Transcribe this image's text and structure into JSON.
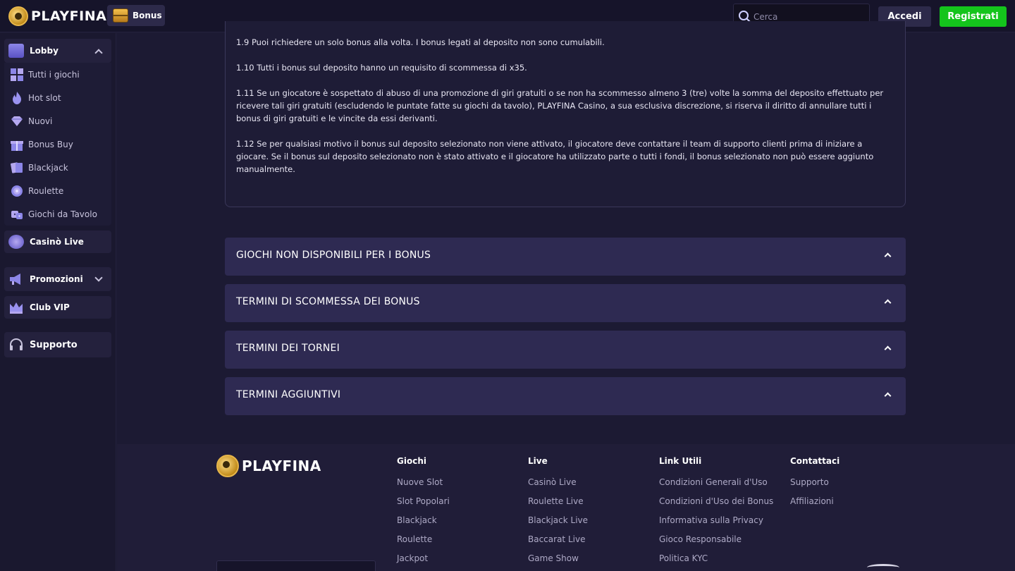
{
  "header": {
    "logo_text": "PLAYFINA",
    "bonus_label": "Bonus",
    "search_placeholder": "Cerca",
    "login_label": "Accedi",
    "register_label": "Registrati"
  },
  "sidebar": {
    "lobby_label": "Lobby",
    "lobby_items": [
      {
        "label": "Tutti i giochi",
        "icon": "grid-icon"
      },
      {
        "label": "Hot slot",
        "icon": "flame-icon"
      },
      {
        "label": "Nuovi",
        "icon": "diamond-icon"
      },
      {
        "label": "Bonus Buy",
        "icon": "gift-icon"
      },
      {
        "label": "Blackjack",
        "icon": "cards-icon"
      },
      {
        "label": "Roulette",
        "icon": "roulette-icon"
      },
      {
        "label": "Giochi da Tavolo",
        "icon": "dice-icon"
      }
    ],
    "live_label": "Casinò Live",
    "promo_label": "Promozioni",
    "vip_label": "Club VIP",
    "support_label": "Supporto"
  },
  "terms": {
    "p1": "1.9 Puoi richiedere un solo bonus alla volta. I bonus legati al deposito non sono cumulabili.",
    "p2": "1.10 Tutti i bonus sul deposito hanno un requisito di scommessa di x35.",
    "p3": "1.11 Se un giocatore è sospettato di abuso di una promozione di giri gratuiti o se non ha scommesso almeno 3 (tre) volte la somma del deposito effettuato per ricevere tali giri gratuiti (escludendo le puntate fatte su giochi da tavolo), PLAYFINA Casino, a sua esclusiva discrezione, si riserva il diritto di annullare tutti i bonus di giri gratuiti e le vincite da essi derivanti.",
    "p4": "1.12 Se per qualsiasi motivo il bonus sul deposito selezionato non viene attivato, il giocatore deve contattare il team di supporto clienti prima di iniziare a giocare. Se il bonus sul deposito selezionato non è stato attivato e il giocatore ha utilizzato parte o tutti i fondi, il bonus selezionato non può essere aggiunto manualmente."
  },
  "accordions": [
    "GIOCHI NON DISPONIBILI PER I BONUS",
    "TERMINI DI SCOMMESSA DEI BONUS",
    "TERMINI DEI TORNEI",
    "TERMINI AGGIUNTIVI"
  ],
  "footer": {
    "logo_text": "PLAYFINA",
    "columns": [
      {
        "head": "Giochi",
        "links": [
          "Nuove Slot",
          "Slot Popolari",
          "Blackjack",
          "Roulette",
          "Jackpot"
        ]
      },
      {
        "head": "Live",
        "links": [
          "Casinò Live",
          "Roulette Live",
          "Blackjack Live",
          "Baccarat Live",
          "Game Show"
        ]
      },
      {
        "head": "Link Utili",
        "links": [
          "Condizioni Generali d'Uso",
          "Condizioni d'Uso dei Bonus",
          "Informativa sulla Privacy",
          "Gioco Responsabile",
          "Politica KYC"
        ]
      },
      {
        "head": "Contattaci",
        "links": [
          "Supporto",
          "Affiliazioni"
        ]
      }
    ]
  }
}
